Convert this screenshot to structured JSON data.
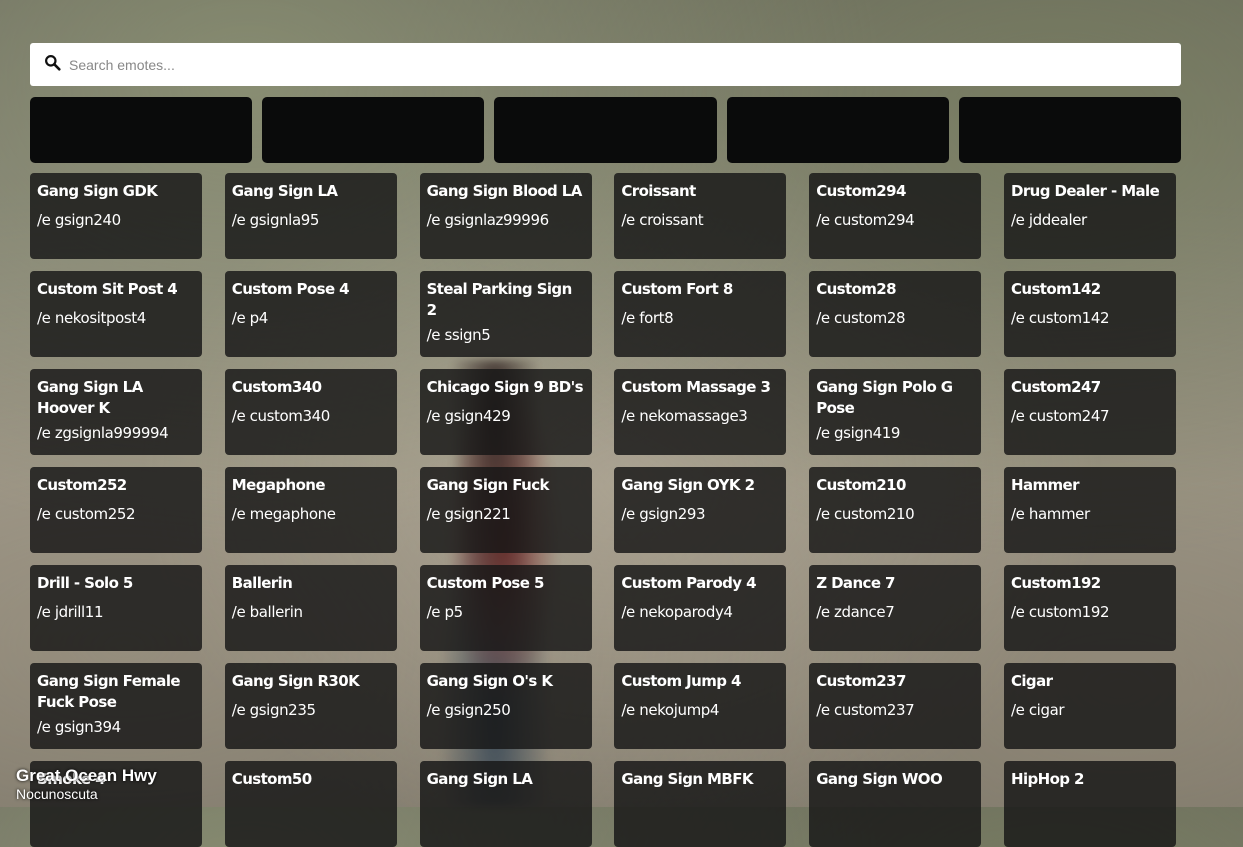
{
  "search": {
    "placeholder": "Search emotes..."
  },
  "tabs": [
    "",
    "",
    "",
    "",
    ""
  ],
  "location": {
    "street": "Great Ocean Hwy",
    "area": "Nocunoscuta"
  },
  "emotes": [
    {
      "name": "Gang Sign GDK",
      "command": "/e gsign240"
    },
    {
      "name": "Gang Sign LA",
      "command": "/e gsignla95"
    },
    {
      "name": "Gang Sign Blood LA",
      "command": "/e gsignlaz99996"
    },
    {
      "name": "Croissant",
      "command": "/e croissant"
    },
    {
      "name": "Custom294",
      "command": "/e custom294"
    },
    {
      "name": "Drug Dealer - Male",
      "command": "/e jddealer"
    },
    {
      "name": "Custom Sit Post 4",
      "command": "/e nekositpost4"
    },
    {
      "name": "Custom Pose 4",
      "command": "/e p4"
    },
    {
      "name": "Steal Parking Sign 2",
      "command": "/e ssign5"
    },
    {
      "name": "Custom Fort 8",
      "command": "/e fort8"
    },
    {
      "name": "Custom28",
      "command": "/e custom28"
    },
    {
      "name": "Custom142",
      "command": "/e custom142"
    },
    {
      "name": "Gang Sign LA Hoover K",
      "command": "/e zgsignla999994"
    },
    {
      "name": "Custom340",
      "command": "/e custom340"
    },
    {
      "name": "Chicago Sign 9 BD's",
      "command": "/e gsign429"
    },
    {
      "name": "Custom Massage 3",
      "command": "/e nekomassage3"
    },
    {
      "name": "Gang Sign Polo G Pose",
      "command": "/e gsign419"
    },
    {
      "name": "Custom247",
      "command": "/e custom247"
    },
    {
      "name": "Custom252",
      "command": "/e custom252"
    },
    {
      "name": "Megaphone",
      "command": "/e megaphone"
    },
    {
      "name": "Gang Sign Fuck",
      "command": "/e gsign221"
    },
    {
      "name": "Gang Sign OYK 2",
      "command": "/e gsign293"
    },
    {
      "name": "Custom210",
      "command": "/e custom210"
    },
    {
      "name": "Hammer",
      "command": "/e hammer"
    },
    {
      "name": "Drill - Solo 5",
      "command": "/e jdrill11"
    },
    {
      "name": "Ballerin",
      "command": "/e ballerin"
    },
    {
      "name": "Custom Pose 5",
      "command": "/e p5"
    },
    {
      "name": "Custom Parody 4",
      "command": "/e nekoparody4"
    },
    {
      "name": "Z Dance 7",
      "command": "/e zdance7"
    },
    {
      "name": "Custom192",
      "command": "/e custom192"
    },
    {
      "name": "Gang Sign Female Fuck Pose",
      "command": "/e gsign394"
    },
    {
      "name": "Gang Sign R30K",
      "command": "/e gsign235"
    },
    {
      "name": "Gang Sign O's K",
      "command": "/e gsign250"
    },
    {
      "name": "Custom Jump 4",
      "command": "/e nekojump4"
    },
    {
      "name": "Custom237",
      "command": "/e custom237"
    },
    {
      "name": "Cigar",
      "command": "/e cigar"
    },
    {
      "name": "Smoke 4",
      "command": ""
    },
    {
      "name": "Custom50",
      "command": ""
    },
    {
      "name": "Gang Sign LA",
      "command": ""
    },
    {
      "name": "Gang Sign MBFK",
      "command": ""
    },
    {
      "name": "Gang Sign WOO",
      "command": ""
    },
    {
      "name": "HipHop 2",
      "command": ""
    }
  ]
}
